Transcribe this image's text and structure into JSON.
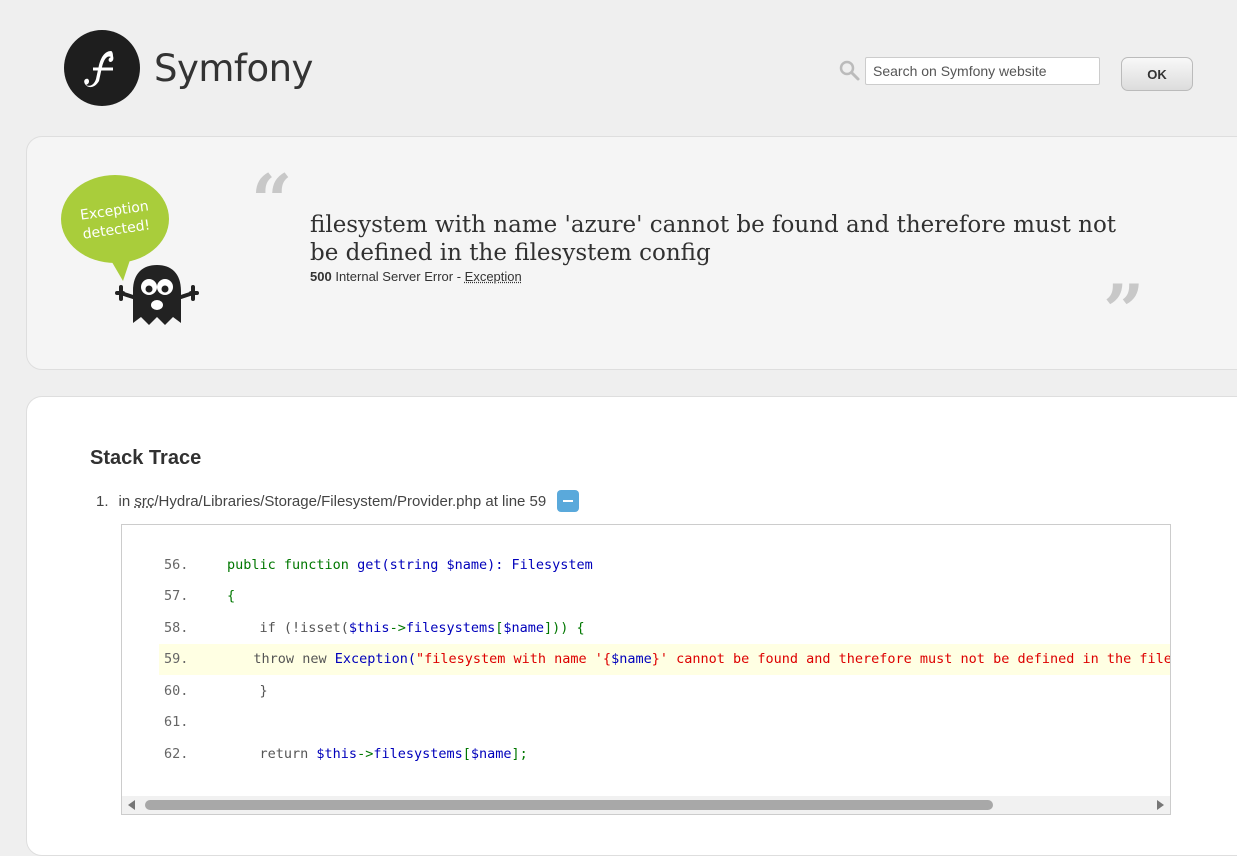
{
  "header": {
    "logo_text": "Symfony",
    "search_placeholder": "Search on Symfony website",
    "ok_label": "OK"
  },
  "exception": {
    "badge_text_line1": "Exception",
    "badge_text_line2": "detected!",
    "message": "filesystem with name 'azure' cannot be found and therefore must not be defined in the filesystem config",
    "status_code": "500",
    "status_text": "Internal Server Error -",
    "class_name": "Exception"
  },
  "trace": {
    "title": "Stack Trace",
    "item_number": "1.",
    "item_in": "in",
    "item_abbr": "src",
    "item_path": "/Hydra/Libraries/Storage/Filesystem/Provider.php at line 59",
    "lines": [
      {
        "num": "56."
      },
      {
        "num": "57."
      },
      {
        "num": "58."
      },
      {
        "num": "59."
      },
      {
        "num": "60."
      },
      {
        "num": "61."
      },
      {
        "num": "62."
      }
    ],
    "code": {
      "l56_kw": "public function",
      "l56_fn": "get(string $name): Filesystem",
      "l57": "{",
      "l58_a": "if (!isset(",
      "l58_b": "$this",
      "l58_c": "->",
      "l58_d": "filesystems",
      "l58_e": "[",
      "l58_f": "$name",
      "l58_g": "])) {",
      "l59_a": "throw new ",
      "l59_b": "Exception(",
      "l59_c": "\"filesystem with name '{",
      "l59_d": "$name",
      "l59_e": "}' cannot be found and therefore must not be defined in the filesystem config\"",
      "l60": "}",
      "l62_a": "return ",
      "l62_b": "$this",
      "l62_c": "->",
      "l62_d": "filesystems",
      "l62_e": "[",
      "l62_f": "$name",
      "l62_g": "];"
    }
  },
  "colors": {
    "accent_blue": "#5aa9db",
    "badge_green": "#a9cd3b",
    "highlight": "#ffffe3"
  }
}
